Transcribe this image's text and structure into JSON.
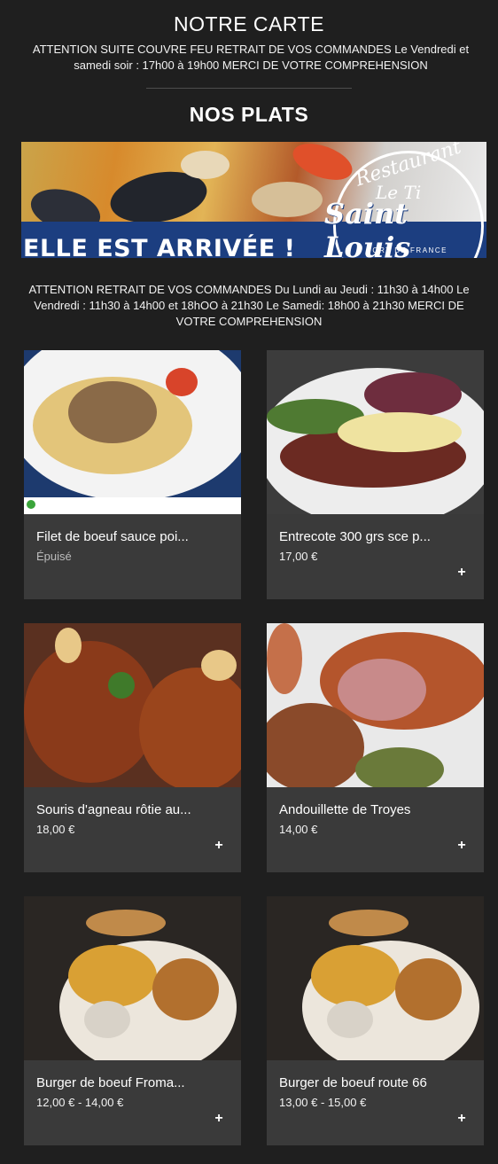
{
  "header": {
    "title": "NOTRE CARTE",
    "notice": "ATTENTION SUITE COUVRE FEU RETRAIT DE VOS COMMANDES Le Vendredi et samedi soir : 17h00 à 19h00 MERCI DE VOTRE COMPREHENSION"
  },
  "section": {
    "title": "NOS PLATS",
    "notice": "ATTENTION RETRAIT DE VOS COMMANDES Du Lundi au Jeudi : 11h30 à 14h00 Le Vendredi : 11h30 à 14h00 et 18hOO à 21h30 Le Samedi: 18h00 à 21h30 MERCI DE VOTRE COMPREHENSION"
  },
  "banner": {
    "slogan": "ELLE EST ARRIVÉE !",
    "logo_line1": "Restaurant",
    "logo_line2": "Le Ti",
    "logo_line3": "Saint Louis",
    "logo_line4": "FORT DE FRANCE"
  },
  "dishes": [
    {
      "name": "Filet de boeuf sauce poi...",
      "price": "Épuisé",
      "add_icon": "plus-icon"
    },
    {
      "name": "Entrecote 300 grs sce p...",
      "price": "17,00 €",
      "add_icon": "plus-icon"
    },
    {
      "name": "Souris d'agneau rôtie au...",
      "price": "18,00 €",
      "add_icon": "plus-icon"
    },
    {
      "name": "Andouillette de Troyes",
      "price": "14,00 €",
      "add_icon": "plus-icon"
    },
    {
      "name": "Burger de boeuf Froma...",
      "price": "12,00 € - 14,00 €",
      "add_icon": "plus-icon"
    },
    {
      "name": "Burger de boeuf route 66",
      "price": "13,00 € - 15,00 €",
      "add_icon": "plus-icon"
    }
  ],
  "add_symbol": "+",
  "colors": {
    "background": "#1f1f1f",
    "card": "#3a3a3a",
    "banner_blue": "#1c3e80"
  }
}
